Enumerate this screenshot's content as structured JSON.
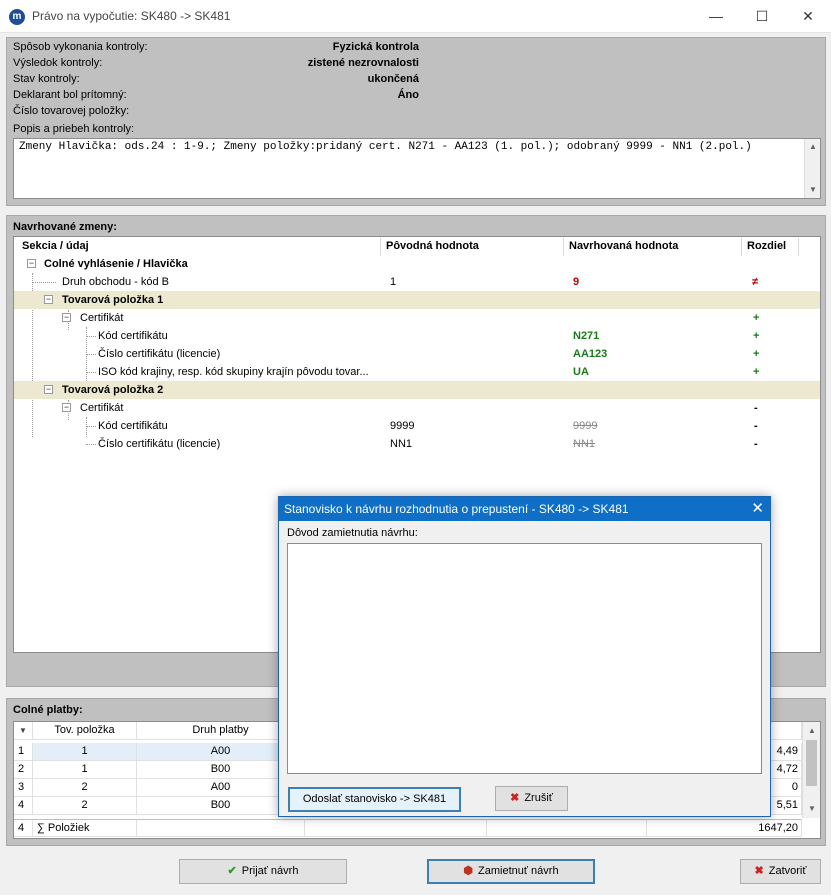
{
  "window": {
    "title": "Právo na vypočutie: SK480 -> SK481",
    "app_icon_letter": "m",
    "minimize_glyph": "—",
    "maximize_glyph": "☐",
    "close_glyph": "✕"
  },
  "control": {
    "fields": [
      {
        "label": "Spôsob vykonania kontroly:",
        "value": "Fyzická kontrola"
      },
      {
        "label": "Výsledok kontroly:",
        "value": "zistené nezrovnalosti"
      },
      {
        "label": "Stav kontroly:",
        "value": "ukončená"
      },
      {
        "label": "Deklarant bol prítomný:",
        "value": "Áno"
      },
      {
        "label": "Číslo tovarovej položky:",
        "value": ""
      }
    ],
    "popis_label": "Popis a priebeh kontroly:",
    "popis_text": "Zmeny Hlavička: ods.24 : 1-9.; Zmeny položky:pridaný cert. N271 - AA123 (1. pol.); odobraný 9999 - NN1 (2.pol.)"
  },
  "changes": {
    "title": "Navrhované zmeny:",
    "columns": {
      "section": "Sekcia / údaj",
      "original": "Pôvodná hodnota",
      "proposed": "Navrhovaná hodnota",
      "diff": "Rozdiel"
    },
    "rows": [
      {
        "label": "Colné vyhlásenie / Hlavička",
        "original": "",
        "proposed": "",
        "diff": ""
      },
      {
        "label": "Druh obchodu - kód B",
        "original": "1",
        "proposed": "9",
        "diff": "≠"
      },
      {
        "label": "Tovarová položka 1",
        "original": "",
        "proposed": "",
        "diff": ""
      },
      {
        "label": "Certifikát",
        "original": "",
        "proposed": "",
        "diff": "+"
      },
      {
        "label": "Kód certifikátu",
        "original": "",
        "proposed": "N271",
        "diff": "+"
      },
      {
        "label": "Číslo certifikátu (licencie)",
        "original": "",
        "proposed": "AA123",
        "diff": "+"
      },
      {
        "label": "ISO kód krajiny, resp. kód skupiny krajín pôvodu tovar...",
        "original": "",
        "proposed": "UA",
        "diff": "+"
      },
      {
        "label": "Tovarová položka 2",
        "original": "",
        "proposed": "",
        "diff": ""
      },
      {
        "label": "Certifikát",
        "original": "",
        "proposed": "",
        "diff": "-"
      },
      {
        "label": "Kód certifikátu",
        "original": "9999",
        "proposed": "9999",
        "diff": "-"
      },
      {
        "label": "Číslo certifikátu (licencie)",
        "original": "NN1",
        "proposed": "NN1",
        "diff": "-"
      }
    ],
    "expander_glyph": "−"
  },
  "payments": {
    "title": "Colné platby:",
    "columns": {
      "item": "Tov. položka",
      "type": "Druh platby"
    },
    "rows": [
      {
        "num": "1",
        "item": "1",
        "type": "A00",
        "amount": "4,49"
      },
      {
        "num": "2",
        "item": "1",
        "type": "B00",
        "amount": "4,72"
      },
      {
        "num": "3",
        "item": "2",
        "type": "A00",
        "amount": "0"
      },
      {
        "num": "4",
        "item": "2",
        "type": "B00",
        "amount": "5,51"
      }
    ],
    "footer": {
      "count": "4",
      "label": "∑ Položiek",
      "total": "1647,20"
    }
  },
  "buttons": {
    "accept": "Prijať návrh",
    "reject": "Zamietnuť návrh",
    "close": "Zatvoriť"
  },
  "dialog": {
    "title": "Stanovisko k návrhu rozhodnutia o prepustení - SK480 -> SK481",
    "reason_label": "Dôvod zamietnutia návrhu:",
    "reason_value": "",
    "send_button": "Odoslať stanovisko -> SK481",
    "cancel_button": "Zrušiť"
  },
  "colors": {
    "dialog_title_bg": "#0f6fc6",
    "highlight_row": "#ede9d0",
    "changed_red": "#c00000",
    "added_green": "#1a7a1a"
  }
}
